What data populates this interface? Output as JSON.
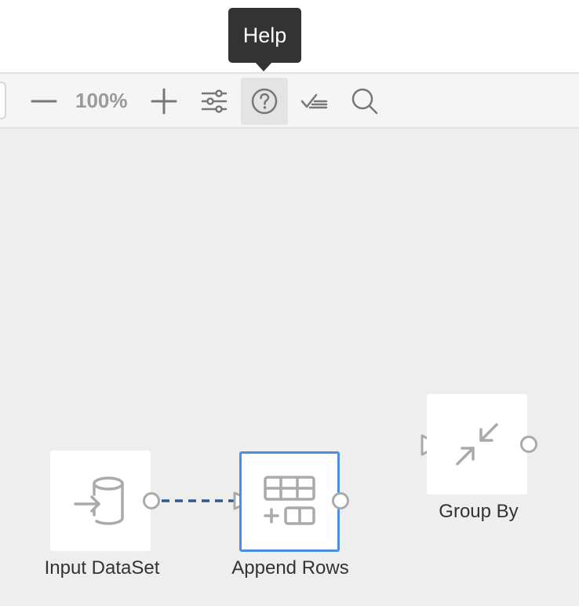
{
  "tooltip": {
    "text": "Help"
  },
  "toolbar": {
    "zoom_level": "100%",
    "buttons": [
      {
        "name": "zoom-out",
        "icon": "minus-icon"
      },
      {
        "name": "zoom-in",
        "icon": "plus-icon"
      },
      {
        "name": "settings",
        "icon": "sliders-icon"
      },
      {
        "name": "help",
        "icon": "help-circle-icon",
        "active": true
      },
      {
        "name": "validate",
        "icon": "check-list-icon"
      },
      {
        "name": "search",
        "icon": "search-icon"
      }
    ]
  },
  "nodes": [
    {
      "label": "Input DataSet",
      "icon": "database-input-icon",
      "selected": false
    },
    {
      "label": "Append Rows",
      "icon": "append-rows-icon",
      "selected": true
    },
    {
      "label": "Group By",
      "icon": "group-by-icon",
      "selected": false
    }
  ],
  "colors": {
    "selection": "#4a90e2",
    "connector": "#2f5a8a",
    "icon_gray": "#aaaaaa",
    "canvas_bg": "#eeeeee",
    "tooltip_bg": "#333333"
  }
}
